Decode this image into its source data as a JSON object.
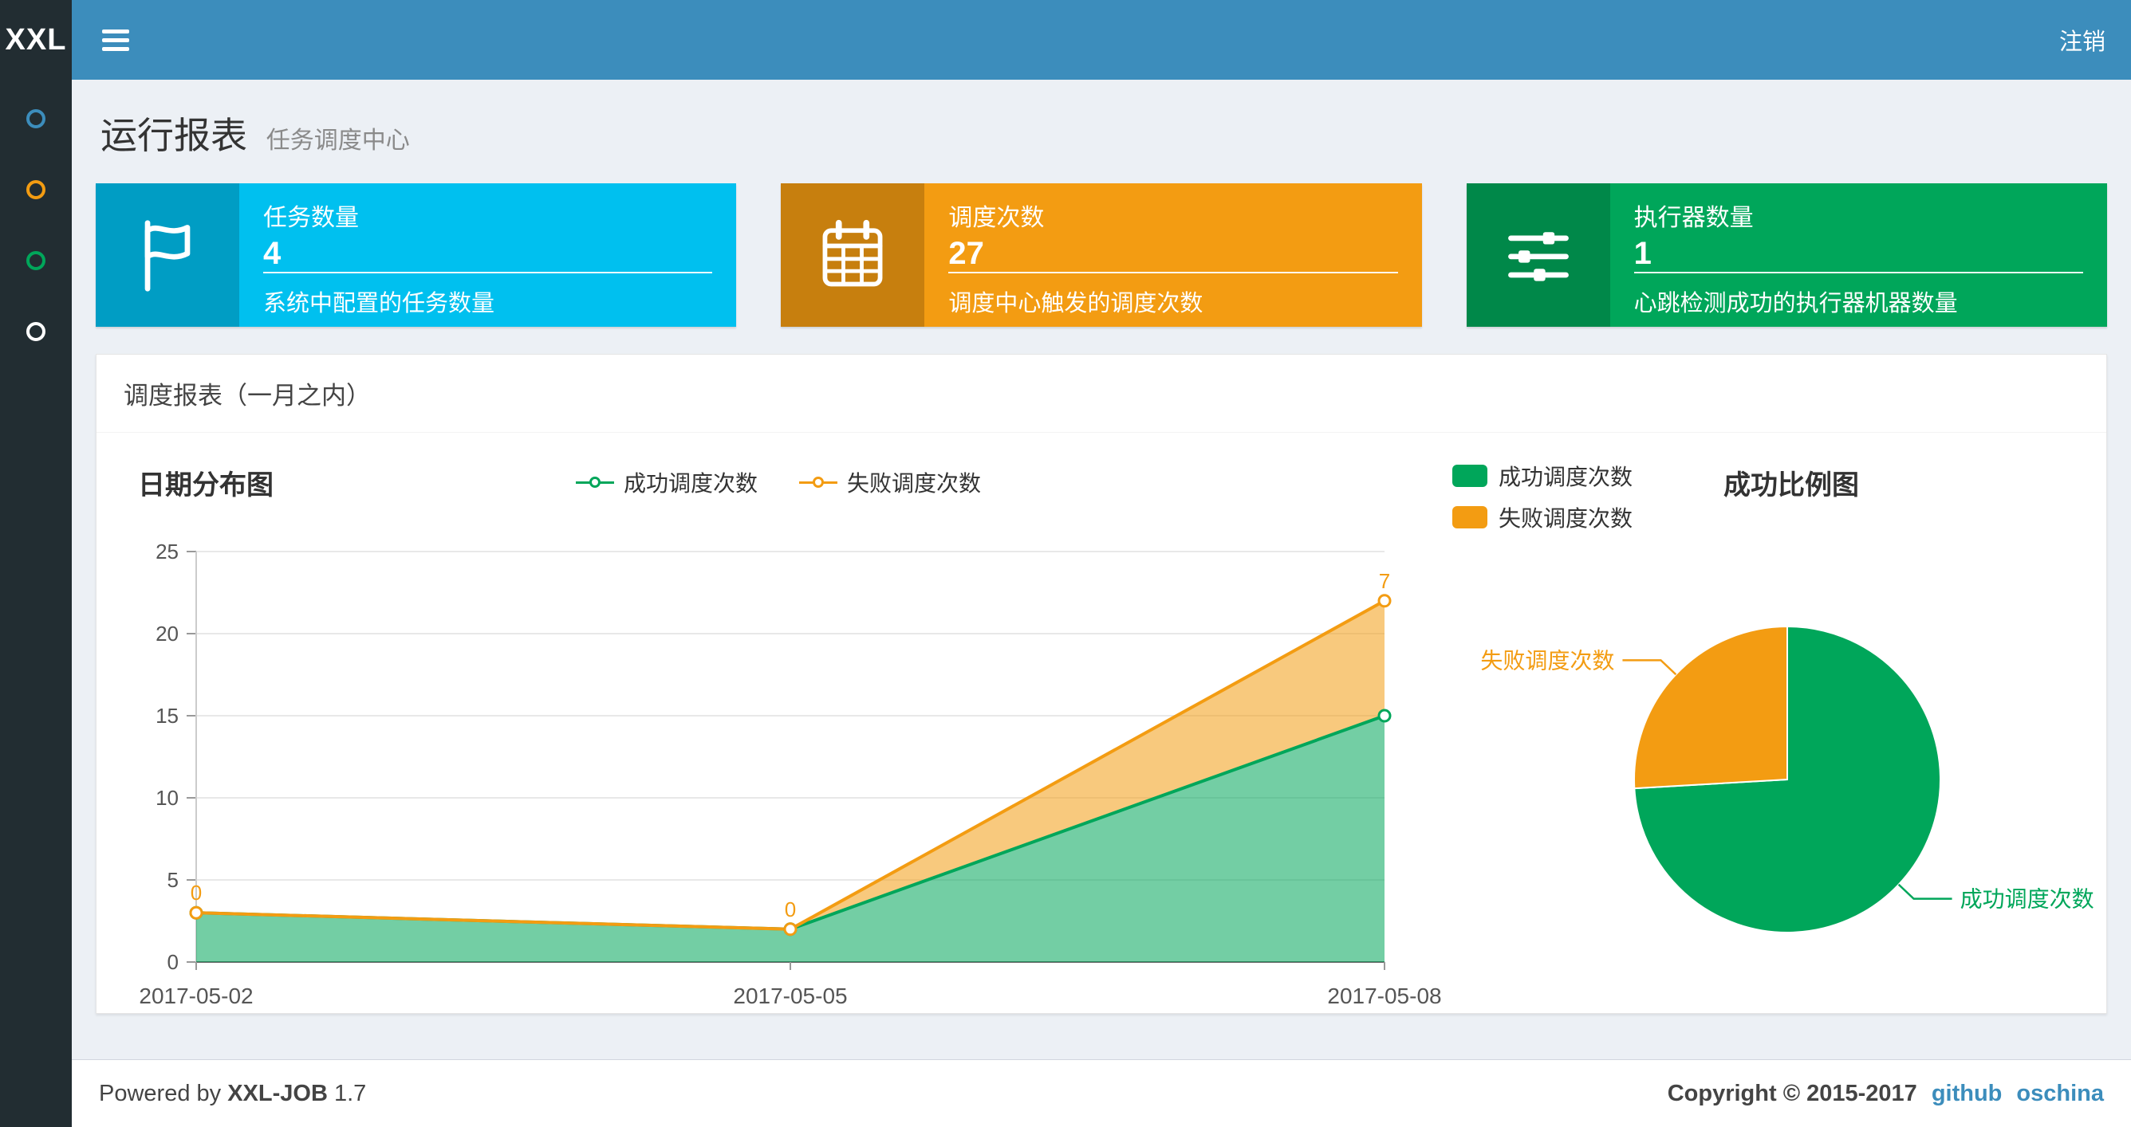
{
  "navbar": {
    "logo": "XXL",
    "logout_label": "注销"
  },
  "sidebar": {
    "items": [
      {
        "icon": "circle-outline-icon",
        "color": "#3c8dbc"
      },
      {
        "icon": "circle-outline-icon",
        "color": "#f39c12"
      },
      {
        "icon": "circle-outline-icon",
        "color": "#00a65a"
      },
      {
        "icon": "circle-outline-icon",
        "color": "#ffffff"
      }
    ]
  },
  "header": {
    "title": "运行报表",
    "subtitle": "任务调度中心"
  },
  "info_boxes": [
    {
      "title": "任务数量",
      "number": "4",
      "desc": "系统中配置的任务数量",
      "color": "#00c0ef",
      "icon": "flag-icon"
    },
    {
      "title": "调度次数",
      "number": "27",
      "desc": "调度中心触发的调度次数",
      "color": "#f39c12",
      "icon": "calendar-icon"
    },
    {
      "title": "执行器数量",
      "number": "1",
      "desc": "心跳检测成功的执行器机器数量",
      "color": "#00a65a",
      "icon": "sliders-icon"
    }
  ],
  "panel": {
    "title": "调度报表（一月之内）"
  },
  "chart_data": [
    {
      "type": "area",
      "title": "日期分布图",
      "x": [
        "2017-05-02",
        "2017-05-05",
        "2017-05-08"
      ],
      "series": [
        {
          "name": "成功调度次数",
          "color": "#00a65a",
          "values": [
            3,
            2,
            15
          ]
        },
        {
          "name": "失败调度次数",
          "color": "#f39c12",
          "values": [
            0,
            0,
            7
          ],
          "labels": [
            "0",
            "0",
            "7"
          ]
        }
      ],
      "stacked": true,
      "ylim": [
        0,
        25
      ],
      "yticks": [
        0,
        5,
        10,
        15,
        20,
        25
      ],
      "legend_position": "top-center",
      "grid": true
    },
    {
      "type": "pie",
      "title": "成功比例图",
      "slices": [
        {
          "name": "成功调度次数",
          "value": 20,
          "color": "#00a65a"
        },
        {
          "name": "失败调度次数",
          "value": 7,
          "color": "#f39c12"
        }
      ],
      "legend_position": "top-left"
    }
  ],
  "footer": {
    "powered_prefix": "Powered by",
    "product": "XXL-JOB",
    "version": "1.7",
    "copyright": "Copyright © 2015-2017",
    "links": [
      "github",
      "oschina"
    ]
  }
}
